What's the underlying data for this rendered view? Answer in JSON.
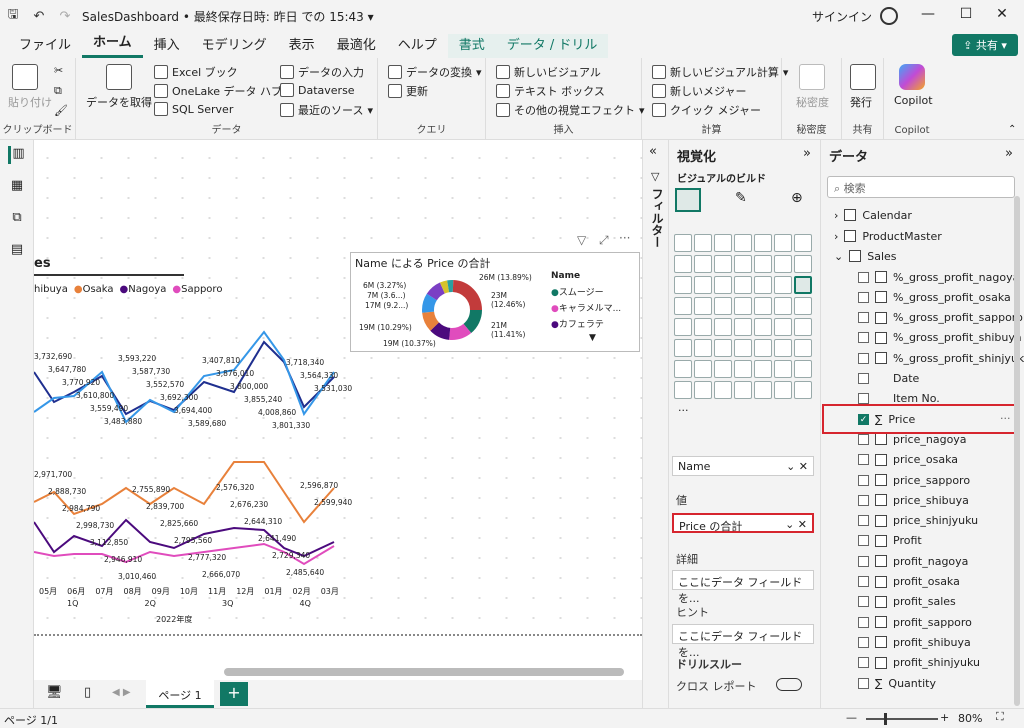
{
  "window": {
    "title": "SalesDashboard • 最終保存日時: 昨日 での 15:43 ▾",
    "signin": "サインイン"
  },
  "tabs": [
    "ファイル",
    "ホーム",
    "挿入",
    "モデリング",
    "表示",
    "最適化",
    "ヘルプ",
    "書式",
    "データ / ドリル"
  ],
  "share": "共有",
  "ribbon": {
    "clipboard": {
      "paste": "貼り付け",
      "label": "クリップボード"
    },
    "data": {
      "getdata": "データを取得",
      "excel": "Excel ブック",
      "onelake": "OneLake データ ハブ",
      "sql": "SQL Server",
      "enter": "データの入力",
      "dataverse": "Dataverse",
      "recent": "最近のソース",
      "label": "データ"
    },
    "query": {
      "transform": "データの変換",
      "refresh": "更新",
      "label": "クエリ"
    },
    "insert": {
      "newvisual": "新しいビジュアル",
      "textbox": "テキスト ボックス",
      "morevisuals": "その他の視覚エフェクト",
      "label": "挿入"
    },
    "calc": {
      "newcalc": "新しいビジュアル計算",
      "newmeasure": "新しいメジャー",
      "quick": "クイック メジャー",
      "label": "計算"
    },
    "sensitivity": {
      "btn": "秘密度",
      "label": "秘密度"
    },
    "share": {
      "publish": "発行",
      "label": "共有"
    },
    "copilot": {
      "btn": "Copilot",
      "label": "Copilot"
    }
  },
  "linechart": {
    "title": "es",
    "legend": [
      "hibuya",
      "Osaka",
      "Nagoya",
      "Sapporo"
    ],
    "top_labels": [
      "3,732,690",
      "3,647,780",
      "3,770,920",
      "3,610,800",
      "3,559,490",
      "3,483,880",
      "3,593,220",
      "3,587,730",
      "3,552,570",
      "3,692,300",
      "3,694,400",
      "3,589,680",
      "3,407,810",
      "3,876,010",
      "3,800,000",
      "3,855,240",
      "4,008,860",
      "3,801,330",
      "3,718,340",
      "3,564,330",
      "3,531,030"
    ],
    "bot_labels": [
      "2,971,700",
      "2,888,730",
      "2,984,790",
      "2,998,730",
      "3,112,850",
      "2,946,910",
      "3,010,460",
      "2,755,890",
      "2,839,700",
      "2,825,660",
      "2,795,560",
      "2,777,320",
      "2,666,070",
      "2,576,320",
      "2,676,230",
      "2,644,310",
      "2,641,490",
      "2,729,340",
      "2,485,640",
      "2,596,870",
      "2,599,940"
    ],
    "months": [
      "05月",
      "06月",
      "07月",
      "08月",
      "09月",
      "10月",
      "11月",
      "12月",
      "01月",
      "02月",
      "03月"
    ],
    "quarters": [
      "1Q",
      "2Q",
      "3Q",
      "4Q"
    ],
    "year": "2022年度"
  },
  "donut": {
    "title": "Name による Price の合計",
    "labels_left": [
      "6M (3.27%)",
      "7M (3.6...)",
      "17M (9.2...)",
      "19M (10.29%)",
      "19M (10.37%)"
    ],
    "labels_right": [
      "26M (13.89%)",
      "23M (12.46%)",
      "21M (11.41%)"
    ],
    "legend_title": "Name",
    "legend": [
      "スムージー",
      "キャラメルマ...",
      "カフェラテ"
    ]
  },
  "viz": {
    "title": "視覚化",
    "build": "ビジュアルのビルド",
    "filter": "フィルター",
    "legend_label": "凡例",
    "legend_value": "Name",
    "value_label": "値",
    "value_value": "Price の合計",
    "detail_label": "詳細",
    "detail_value": "ここにデータ フィールドを...",
    "tooltip_label": "ヒント",
    "tooltip_value": "ここにデータ フィールドを...",
    "drill_label": "ドリルスルー",
    "cross_label": "クロス レポート"
  },
  "data_pane": {
    "title": "データ",
    "search": "検索",
    "tables": [
      "Calendar",
      "ProductMaster",
      "Sales"
    ],
    "fields": [
      "%_gross_profit_nagoya",
      "%_gross_profit_osaka",
      "%_gross_profit_sapporo",
      "%_gross_profit_shibuya",
      "%_gross_profit_shinjyuku",
      "Date",
      "Item No.",
      "Price",
      "price_nagoya",
      "price_osaka",
      "price_sapporo",
      "price_shibuya",
      "price_shinjyuku",
      "Profit",
      "profit_nagoya",
      "profit_osaka",
      "profit_sales",
      "profit_sapporo",
      "profit_shibuya",
      "profit_shinjyuku",
      "Quantity"
    ]
  },
  "pages": {
    "tab": "ページ 1",
    "add": "+"
  },
  "status": {
    "page": "ページ 1/1",
    "zoom": "80%"
  }
}
